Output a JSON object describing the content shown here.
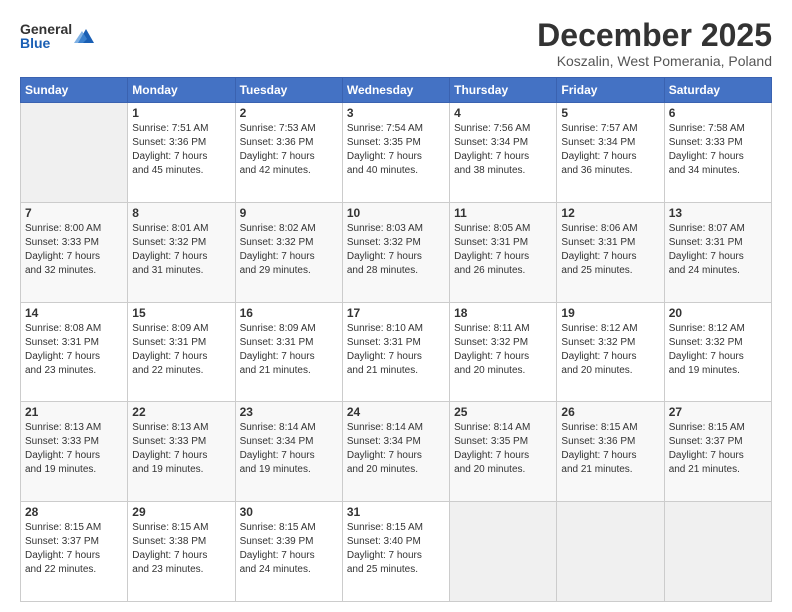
{
  "logo": {
    "general": "General",
    "blue": "Blue"
  },
  "header": {
    "month": "December 2025",
    "location": "Koszalin, West Pomerania, Poland"
  },
  "weekdays": [
    "Sunday",
    "Monday",
    "Tuesday",
    "Wednesday",
    "Thursday",
    "Friday",
    "Saturday"
  ],
  "weeks": [
    [
      {
        "day": "",
        "info": ""
      },
      {
        "day": "1",
        "info": "Sunrise: 7:51 AM\nSunset: 3:36 PM\nDaylight: 7 hours\nand 45 minutes."
      },
      {
        "day": "2",
        "info": "Sunrise: 7:53 AM\nSunset: 3:36 PM\nDaylight: 7 hours\nand 42 minutes."
      },
      {
        "day": "3",
        "info": "Sunrise: 7:54 AM\nSunset: 3:35 PM\nDaylight: 7 hours\nand 40 minutes."
      },
      {
        "day": "4",
        "info": "Sunrise: 7:56 AM\nSunset: 3:34 PM\nDaylight: 7 hours\nand 38 minutes."
      },
      {
        "day": "5",
        "info": "Sunrise: 7:57 AM\nSunset: 3:34 PM\nDaylight: 7 hours\nand 36 minutes."
      },
      {
        "day": "6",
        "info": "Sunrise: 7:58 AM\nSunset: 3:33 PM\nDaylight: 7 hours\nand 34 minutes."
      }
    ],
    [
      {
        "day": "7",
        "info": "Sunrise: 8:00 AM\nSunset: 3:33 PM\nDaylight: 7 hours\nand 32 minutes."
      },
      {
        "day": "8",
        "info": "Sunrise: 8:01 AM\nSunset: 3:32 PM\nDaylight: 7 hours\nand 31 minutes."
      },
      {
        "day": "9",
        "info": "Sunrise: 8:02 AM\nSunset: 3:32 PM\nDaylight: 7 hours\nand 29 minutes."
      },
      {
        "day": "10",
        "info": "Sunrise: 8:03 AM\nSunset: 3:32 PM\nDaylight: 7 hours\nand 28 minutes."
      },
      {
        "day": "11",
        "info": "Sunrise: 8:05 AM\nSunset: 3:31 PM\nDaylight: 7 hours\nand 26 minutes."
      },
      {
        "day": "12",
        "info": "Sunrise: 8:06 AM\nSunset: 3:31 PM\nDaylight: 7 hours\nand 25 minutes."
      },
      {
        "day": "13",
        "info": "Sunrise: 8:07 AM\nSunset: 3:31 PM\nDaylight: 7 hours\nand 24 minutes."
      }
    ],
    [
      {
        "day": "14",
        "info": "Sunrise: 8:08 AM\nSunset: 3:31 PM\nDaylight: 7 hours\nand 23 minutes."
      },
      {
        "day": "15",
        "info": "Sunrise: 8:09 AM\nSunset: 3:31 PM\nDaylight: 7 hours\nand 22 minutes."
      },
      {
        "day": "16",
        "info": "Sunrise: 8:09 AM\nSunset: 3:31 PM\nDaylight: 7 hours\nand 21 minutes."
      },
      {
        "day": "17",
        "info": "Sunrise: 8:10 AM\nSunset: 3:31 PM\nDaylight: 7 hours\nand 21 minutes."
      },
      {
        "day": "18",
        "info": "Sunrise: 8:11 AM\nSunset: 3:32 PM\nDaylight: 7 hours\nand 20 minutes."
      },
      {
        "day": "19",
        "info": "Sunrise: 8:12 AM\nSunset: 3:32 PM\nDaylight: 7 hours\nand 20 minutes."
      },
      {
        "day": "20",
        "info": "Sunrise: 8:12 AM\nSunset: 3:32 PM\nDaylight: 7 hours\nand 19 minutes."
      }
    ],
    [
      {
        "day": "21",
        "info": "Sunrise: 8:13 AM\nSunset: 3:33 PM\nDaylight: 7 hours\nand 19 minutes."
      },
      {
        "day": "22",
        "info": "Sunrise: 8:13 AM\nSunset: 3:33 PM\nDaylight: 7 hours\nand 19 minutes."
      },
      {
        "day": "23",
        "info": "Sunrise: 8:14 AM\nSunset: 3:34 PM\nDaylight: 7 hours\nand 19 minutes."
      },
      {
        "day": "24",
        "info": "Sunrise: 8:14 AM\nSunset: 3:34 PM\nDaylight: 7 hours\nand 20 minutes."
      },
      {
        "day": "25",
        "info": "Sunrise: 8:14 AM\nSunset: 3:35 PM\nDaylight: 7 hours\nand 20 minutes."
      },
      {
        "day": "26",
        "info": "Sunrise: 8:15 AM\nSunset: 3:36 PM\nDaylight: 7 hours\nand 21 minutes."
      },
      {
        "day": "27",
        "info": "Sunrise: 8:15 AM\nSunset: 3:37 PM\nDaylight: 7 hours\nand 21 minutes."
      }
    ],
    [
      {
        "day": "28",
        "info": "Sunrise: 8:15 AM\nSunset: 3:37 PM\nDaylight: 7 hours\nand 22 minutes."
      },
      {
        "day": "29",
        "info": "Sunrise: 8:15 AM\nSunset: 3:38 PM\nDaylight: 7 hours\nand 23 minutes."
      },
      {
        "day": "30",
        "info": "Sunrise: 8:15 AM\nSunset: 3:39 PM\nDaylight: 7 hours\nand 24 minutes."
      },
      {
        "day": "31",
        "info": "Sunrise: 8:15 AM\nSunset: 3:40 PM\nDaylight: 7 hours\nand 25 minutes."
      },
      {
        "day": "",
        "info": ""
      },
      {
        "day": "",
        "info": ""
      },
      {
        "day": "",
        "info": ""
      }
    ]
  ]
}
